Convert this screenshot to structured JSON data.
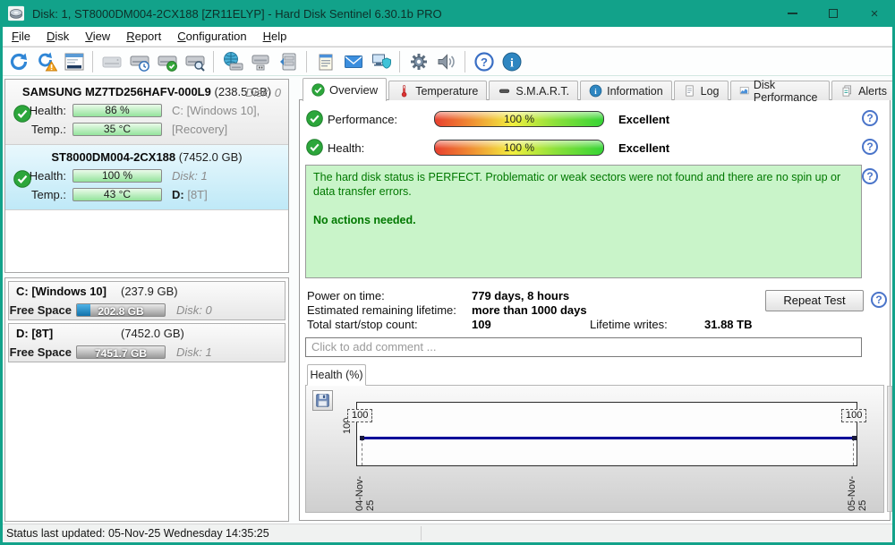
{
  "window": {
    "title": "Disk: 1, ST8000DM004-2CX188 [ZR11ELYP] - Hard Disk Sentinel 6.30.1b PRO"
  },
  "menu": {
    "items": [
      "File",
      "Disk",
      "View",
      "Report",
      "Configuration",
      "Help"
    ]
  },
  "toolbar": {
    "icons": [
      "refresh-icon",
      "refresh-warning-icon",
      "details-panel-icon",
      "disk-offline-icon",
      "disk-schedule-icon",
      "disk-test-ok-icon",
      "disk-surface-test-icon",
      "disk-network-icon",
      "disk-usb-icon",
      "disk-remove-icon",
      "report-notepad-icon",
      "email-report-icon",
      "network-status-icon",
      "settings-gear-icon",
      "sound-alerts-icon",
      "help-icon",
      "about-info-icon"
    ]
  },
  "tabs": {
    "items": [
      "Overview",
      "Temperature",
      "S.M.A.R.T.",
      "Information",
      "Log",
      "Disk Performance",
      "Alerts"
    ],
    "active": "Overview"
  },
  "sidebar": {
    "disks": [
      {
        "model": "SAMSUNG MZ7TD256HAFV-000L9",
        "size": "(238.5 GB)",
        "disk_label": "Disk: 0",
        "health_label": "Health:",
        "health_value": "86 %",
        "temp_label": "Temp.:",
        "temp_value": "35 °C",
        "right_line1": "C: [Windows 10],",
        "right_line2": "[Recovery]"
      },
      {
        "model": "ST8000DM004-2CX188",
        "size": "(7452.0 GB)",
        "health_label": "Health:",
        "health_value": "100 %",
        "temp_label": "Temp.:",
        "temp_value": "43 °C",
        "right_line1": "Disk: 1",
        "right_line2_letter": "D:",
        "right_line2_name": "[8T]"
      }
    ],
    "partitions": [
      {
        "name": "C: [Windows 10]",
        "size": "(237.9 GB)",
        "free_label": "Free Space",
        "free_value": "202.8 GB",
        "disk_label": "Disk: 0",
        "used_percent": 15
      },
      {
        "name": "D: [8T]",
        "size": "(7452.0 GB)",
        "free_label": "Free Space",
        "free_value": "7451.7 GB",
        "disk_label": "Disk: 1",
        "used_percent": 0
      }
    ]
  },
  "overview": {
    "performance_label": "Performance:",
    "performance_value": "100 %",
    "performance_rating": "Excellent",
    "health_label": "Health:",
    "health_value": "100 %",
    "health_rating": "Excellent",
    "status_paragraph": "The hard disk status is PERFECT. Problematic or weak sectors were not found and there are no spin up or data transfer errors.",
    "status_action": "No actions needed.",
    "stats": [
      {
        "label": "Power on time:",
        "value": "779 days, 8 hours"
      },
      {
        "label": "Estimated remaining lifetime:",
        "value": "more than 1000 days"
      },
      {
        "label": "Total start/stop count:",
        "value": "109"
      },
      {
        "label": "Lifetime writes:",
        "value": "31.88 TB"
      }
    ],
    "repeat_test_label": "Repeat Test",
    "comment_placeholder": "Click to add comment ...",
    "chart_tab_label": "Health (%)"
  },
  "chart_data": {
    "type": "line",
    "title": "Health (%)",
    "x": [
      "04-Nov-25",
      "05-Nov-25"
    ],
    "series": [
      {
        "name": "Health (%)",
        "values": [
          100,
          100
        ]
      }
    ],
    "point_labels": [
      "100",
      "100"
    ],
    "y_tick_labels": [
      "100"
    ],
    "ylim": [
      0,
      100
    ],
    "line_color": "#000099",
    "grid": false,
    "legend": false
  },
  "status_bar": {
    "text": "Status last updated: 05-Nov-25 Wednesday 14:35:25"
  },
  "icons": {
    "help_glyph": "?",
    "minimize_glyph": "–",
    "close_glyph": "×",
    "check_glyph": "✓"
  },
  "colors": {
    "titlebar": "#12a28a",
    "selected_disk_bg": "#c9ecf8",
    "health_bar_green": "#a9e7ae",
    "gauge_gradient": [
      "#e8402f",
      "#f2ef3f",
      "#35d435"
    ],
    "status_box_bg": "#c9f4c9",
    "status_text_green": "#007800",
    "used_space_blue": "#1f9ad6",
    "help_icon_blue": "#4a74c9"
  }
}
